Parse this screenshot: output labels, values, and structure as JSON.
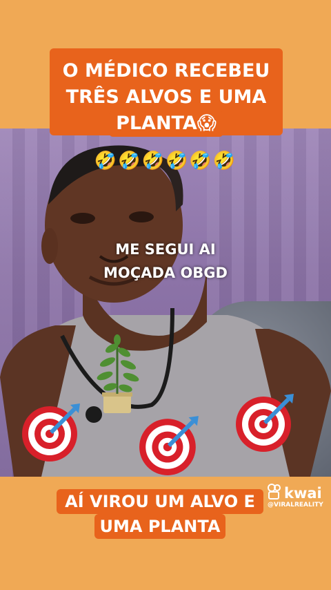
{
  "top_caption": {
    "line1": "O MÉDICO RECEBEU",
    "line2": "TRÊS ALVOS E UMA",
    "line3": "PLANTA😱"
  },
  "emoji_row": "🤣🤣🤣🤣🤣🤣",
  "overlay_text": {
    "line1": "ME SEGUI AI",
    "line2": "MOÇADA OBGD"
  },
  "bottom_caption": {
    "line1": "AÍ VIROU UM ALVO E",
    "line2": "UMA PLANTA"
  },
  "watermark": {
    "brand": "kwai",
    "handle": "@VIRALREALITY"
  },
  "colors": {
    "background": "#f0a955",
    "caption_bg": "#e8631c",
    "target_red": "#d8202a",
    "dart_blue": "#3a8fd6"
  },
  "icons": [
    "target-dart-icon",
    "potted-plant-icon",
    "kwai-logo-icon"
  ]
}
